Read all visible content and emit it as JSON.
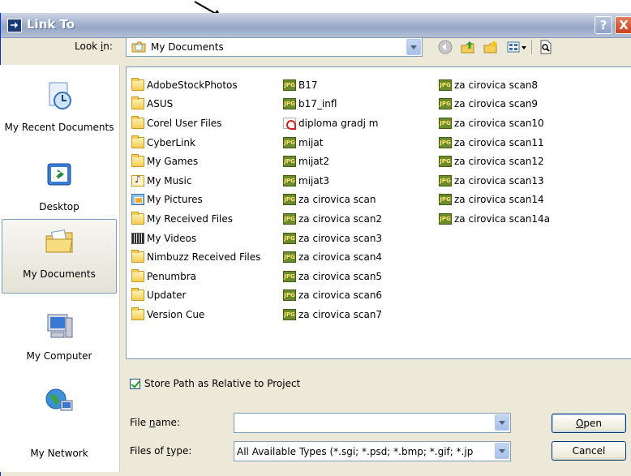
{
  "window": {
    "title": "Link To",
    "help_label": "?",
    "close_label": "X"
  },
  "look_in": {
    "label_pre": "Look ",
    "label_u": "i",
    "label_post": "n:",
    "value": "My Documents"
  },
  "toolbar": {
    "icons": [
      "back-icon",
      "up-folder-icon",
      "new-folder-icon",
      "views-menu-icon",
      "preview-icon"
    ]
  },
  "places": [
    {
      "label": "My Recent Documents",
      "icon": "recent-documents-icon"
    },
    {
      "label": "Desktop",
      "icon": "desktop-icon"
    },
    {
      "label": "My Documents",
      "icon": "my-documents-icon",
      "selected": true
    },
    {
      "label": "My Computer",
      "icon": "my-computer-icon"
    },
    {
      "label": "My Network",
      "icon": "my-network-icon"
    }
  ],
  "files": {
    "col1": [
      {
        "name": "AdobeStockPhotos",
        "type": "folder"
      },
      {
        "name": "ASUS",
        "type": "folder"
      },
      {
        "name": "Corel User Files",
        "type": "folder"
      },
      {
        "name": "CyberLink",
        "type": "folder"
      },
      {
        "name": "My Games",
        "type": "folder"
      },
      {
        "name": "My Music",
        "type": "music"
      },
      {
        "name": "My Pictures",
        "type": "pics"
      },
      {
        "name": "My Received Files",
        "type": "folder"
      },
      {
        "name": "My Videos",
        "type": "videos"
      },
      {
        "name": "Nimbuzz Received Files",
        "type": "folder"
      },
      {
        "name": "Penumbra",
        "type": "folder"
      },
      {
        "name": "Updater",
        "type": "folder"
      },
      {
        "name": "Version Cue",
        "type": "folder"
      }
    ],
    "col2": [
      {
        "name": "B17",
        "type": "jpg"
      },
      {
        "name": "b17_infl",
        "type": "jpg"
      },
      {
        "name": "diploma gradj m",
        "type": "pdf"
      },
      {
        "name": "mijat",
        "type": "jpg"
      },
      {
        "name": "mijat2",
        "type": "jpg"
      },
      {
        "name": "mijat3",
        "type": "jpg"
      },
      {
        "name": "za cirovica scan",
        "type": "jpg"
      },
      {
        "name": "za cirovica scan2",
        "type": "jpg"
      },
      {
        "name": "za cirovica scan3",
        "type": "jpg"
      },
      {
        "name": "za cirovica scan4",
        "type": "jpg"
      },
      {
        "name": "za cirovica scan5",
        "type": "jpg"
      },
      {
        "name": "za cirovica scan6",
        "type": "jpg"
      },
      {
        "name": "za cirovica scan7",
        "type": "jpg"
      }
    ],
    "col3": [
      {
        "name": "za cirovica scan8",
        "type": "jpg"
      },
      {
        "name": "za cirovica scan9",
        "type": "jpg"
      },
      {
        "name": "za cirovica scan10",
        "type": "jpg"
      },
      {
        "name": "za cirovica scan11",
        "type": "jpg"
      },
      {
        "name": "za cirovica scan12",
        "type": "jpg"
      },
      {
        "name": "za cirovica scan13",
        "type": "jpg"
      },
      {
        "name": "za cirovica scan14",
        "type": "jpg"
      },
      {
        "name": "za cirovica scan14a",
        "type": "jpg"
      }
    ],
    "jpg_badge": "JPG"
  },
  "store_path": {
    "label": "Store Path as Relative to Project",
    "checked": true
  },
  "file_name": {
    "label_pre": "File ",
    "label_u": "n",
    "label_post": "ame:",
    "value": ""
  },
  "file_type": {
    "label_pre": "Files of ",
    "label_u": "t",
    "label_post": "ype:",
    "value": "All Available Types (*.sgi; *.psd; *.bmp; *.gif; *.jp"
  },
  "buttons": {
    "open_u": "O",
    "open_rest": "pen",
    "cancel": "Cancel"
  }
}
